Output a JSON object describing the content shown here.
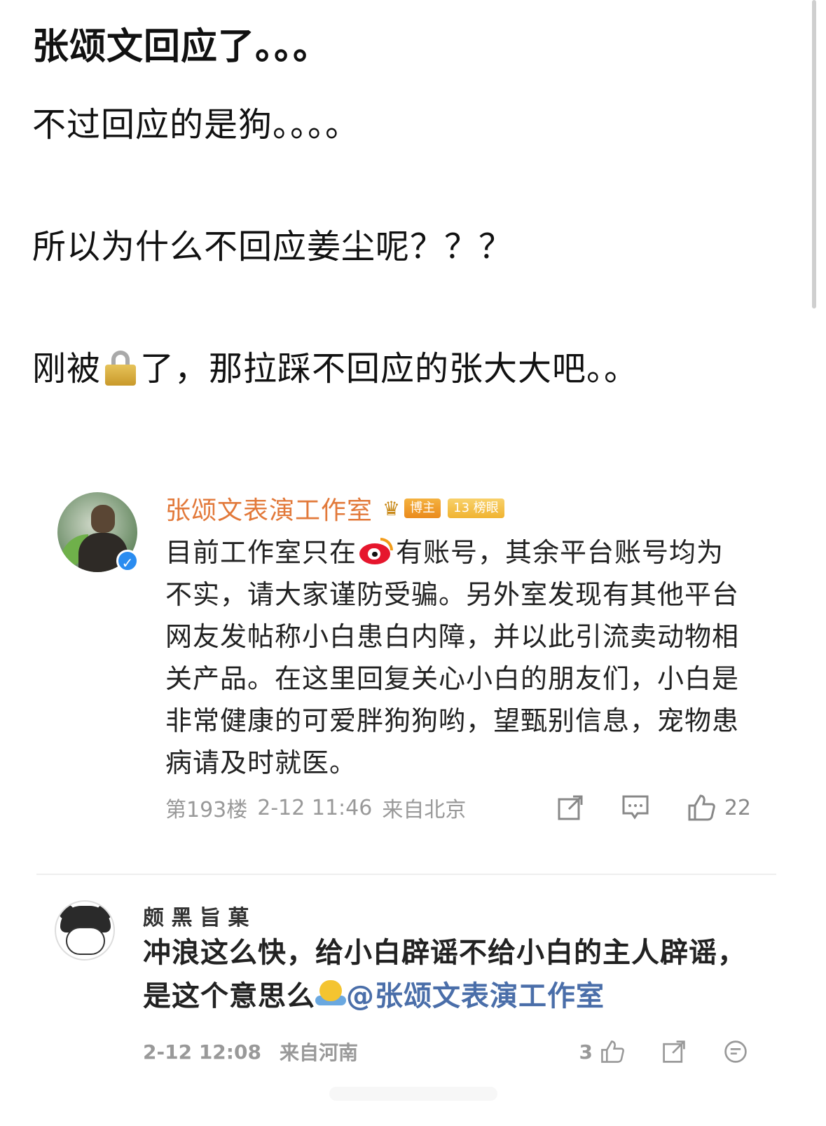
{
  "post": {
    "title": "张颂文回应了。。。",
    "line1": "不过回应的是狗。。。。",
    "line2": "所以为什么不回应姜尘呢？？？",
    "line3_before": "刚被",
    "line3_after": "了，那拉踩不回应的张大大吧。。",
    "lock_icon": "lock-icon"
  },
  "comment1": {
    "name": "张颂文表演工作室",
    "badge_bozhu": "博主",
    "badge_rank_num": "13",
    "badge_rank_label": "榜眼",
    "text_before_logo": "目前工作室只在",
    "text_after_logo": "有账号，其余平台账号均为不实，请大家谨防受骗。另外室发现有其他平台网友发帖称小白患白内障，并以此引流卖动物相关产品。在这里回复关心小白的朋友们，小白是非常健康的可爱胖狗狗哟，望甄别信息，宠物患病请及时就医。",
    "floor": "第193楼",
    "time": "2-12 11:46",
    "location": "来自北京",
    "likes": "22",
    "name_color": "#e2793a"
  },
  "comment2": {
    "name": "颇 黑 旨 菓",
    "text_before_emoji": "冲浪这么快，给小白辟谣不给小白的主人辟谣，是这个意思么",
    "mention": "@张颂文表演工作室",
    "time": "2-12 12:08",
    "location": "来自河南",
    "likes": "3",
    "mention_color": "#4a6ea9"
  }
}
